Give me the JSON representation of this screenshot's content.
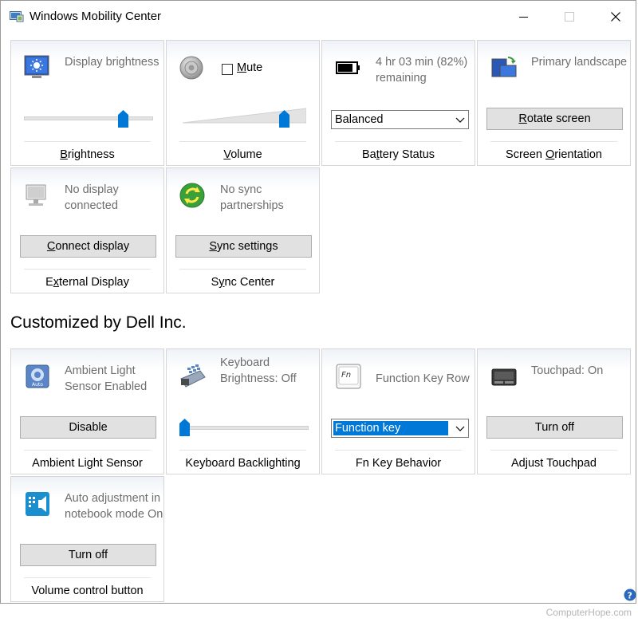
{
  "window": {
    "title": "Windows Mobility Center",
    "controls": {
      "minimize": "minimize",
      "maximize": "maximize",
      "close": "close"
    }
  },
  "tiles": {
    "brightness": {
      "desc": "Display brightness",
      "caption": "Brightness",
      "level": 0.79
    },
    "volume": {
      "mute_label": "Mute",
      "muted": false,
      "caption": "Volume",
      "level": 0.85
    },
    "battery": {
      "desc": "4 hr 03 min (82%) remaining",
      "plan": "Balanced",
      "caption": "Battery Status",
      "charge_percent": 82
    },
    "orientation": {
      "desc": "Primary landscape",
      "button": "Rotate screen",
      "caption": "Screen Orientation"
    },
    "external_display": {
      "desc": "No display connected",
      "button": "Connect display",
      "caption": "External Display"
    },
    "sync_center": {
      "desc": "No sync partnerships",
      "button": "Sync settings",
      "caption": "Sync Center"
    }
  },
  "custom_section": {
    "heading": "Customized by Dell Inc.",
    "tiles": {
      "ambient_light": {
        "desc": "Ambient Light Sensor Enabled",
        "button": "Disable",
        "caption": "Ambient Light Sensor"
      },
      "keyboard_backlight": {
        "desc": "Keyboard Brightness: Off",
        "caption": "Keyboard Backlighting",
        "level": 0.0
      },
      "fn_key": {
        "desc": "Function Key Row",
        "selected": "Function key",
        "caption": "Fn Key Behavior",
        "icon_text": "Fn"
      },
      "touchpad": {
        "desc": "Touchpad: On",
        "button": "Turn off",
        "caption": "Adjust Touchpad"
      },
      "volume_button": {
        "desc": "Auto adjustment in notebook mode On",
        "button": "Turn off",
        "caption": "Volume control button"
      }
    }
  },
  "watermark": "ComputerHope.com",
  "icons": {
    "app": "mobility-center-icon",
    "brightness": "brightness-icon",
    "volume": "speaker-icon",
    "battery": "battery-icon",
    "orientation": "rotate-display-icon",
    "display": "monitor-icon",
    "sync": "sync-icon",
    "ambient": "ambient-light-icon",
    "keyboard": "keyboard-icon",
    "fn": "fn-key-icon",
    "touchpad": "touchpad-icon",
    "volume_button": "volume-button-icon",
    "help": "help-icon"
  },
  "colors": {
    "accent": "#0078d7",
    "thumb": "#0078d7",
    "button_bg": "#e1e1e1"
  }
}
